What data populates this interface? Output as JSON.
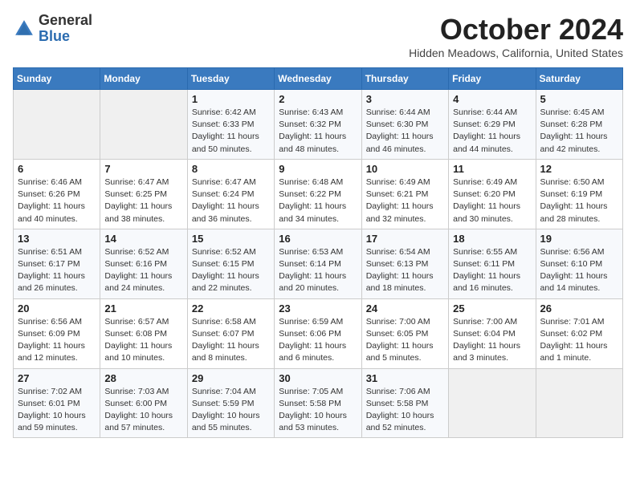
{
  "header": {
    "logo_general": "General",
    "logo_blue": "Blue",
    "month_title": "October 2024",
    "location": "Hidden Meadows, California, United States"
  },
  "days_of_week": [
    "Sunday",
    "Monday",
    "Tuesday",
    "Wednesday",
    "Thursday",
    "Friday",
    "Saturday"
  ],
  "weeks": [
    [
      {
        "day": "",
        "info": ""
      },
      {
        "day": "",
        "info": ""
      },
      {
        "day": "1",
        "info": "Sunrise: 6:42 AM\nSunset: 6:33 PM\nDaylight: 11 hours and 50 minutes."
      },
      {
        "day": "2",
        "info": "Sunrise: 6:43 AM\nSunset: 6:32 PM\nDaylight: 11 hours and 48 minutes."
      },
      {
        "day": "3",
        "info": "Sunrise: 6:44 AM\nSunset: 6:30 PM\nDaylight: 11 hours and 46 minutes."
      },
      {
        "day": "4",
        "info": "Sunrise: 6:44 AM\nSunset: 6:29 PM\nDaylight: 11 hours and 44 minutes."
      },
      {
        "day": "5",
        "info": "Sunrise: 6:45 AM\nSunset: 6:28 PM\nDaylight: 11 hours and 42 minutes."
      }
    ],
    [
      {
        "day": "6",
        "info": "Sunrise: 6:46 AM\nSunset: 6:26 PM\nDaylight: 11 hours and 40 minutes."
      },
      {
        "day": "7",
        "info": "Sunrise: 6:47 AM\nSunset: 6:25 PM\nDaylight: 11 hours and 38 minutes."
      },
      {
        "day": "8",
        "info": "Sunrise: 6:47 AM\nSunset: 6:24 PM\nDaylight: 11 hours and 36 minutes."
      },
      {
        "day": "9",
        "info": "Sunrise: 6:48 AM\nSunset: 6:22 PM\nDaylight: 11 hours and 34 minutes."
      },
      {
        "day": "10",
        "info": "Sunrise: 6:49 AM\nSunset: 6:21 PM\nDaylight: 11 hours and 32 minutes."
      },
      {
        "day": "11",
        "info": "Sunrise: 6:49 AM\nSunset: 6:20 PM\nDaylight: 11 hours and 30 minutes."
      },
      {
        "day": "12",
        "info": "Sunrise: 6:50 AM\nSunset: 6:19 PM\nDaylight: 11 hours and 28 minutes."
      }
    ],
    [
      {
        "day": "13",
        "info": "Sunrise: 6:51 AM\nSunset: 6:17 PM\nDaylight: 11 hours and 26 minutes."
      },
      {
        "day": "14",
        "info": "Sunrise: 6:52 AM\nSunset: 6:16 PM\nDaylight: 11 hours and 24 minutes."
      },
      {
        "day": "15",
        "info": "Sunrise: 6:52 AM\nSunset: 6:15 PM\nDaylight: 11 hours and 22 minutes."
      },
      {
        "day": "16",
        "info": "Sunrise: 6:53 AM\nSunset: 6:14 PM\nDaylight: 11 hours and 20 minutes."
      },
      {
        "day": "17",
        "info": "Sunrise: 6:54 AM\nSunset: 6:13 PM\nDaylight: 11 hours and 18 minutes."
      },
      {
        "day": "18",
        "info": "Sunrise: 6:55 AM\nSunset: 6:11 PM\nDaylight: 11 hours and 16 minutes."
      },
      {
        "day": "19",
        "info": "Sunrise: 6:56 AM\nSunset: 6:10 PM\nDaylight: 11 hours and 14 minutes."
      }
    ],
    [
      {
        "day": "20",
        "info": "Sunrise: 6:56 AM\nSunset: 6:09 PM\nDaylight: 11 hours and 12 minutes."
      },
      {
        "day": "21",
        "info": "Sunrise: 6:57 AM\nSunset: 6:08 PM\nDaylight: 11 hours and 10 minutes."
      },
      {
        "day": "22",
        "info": "Sunrise: 6:58 AM\nSunset: 6:07 PM\nDaylight: 11 hours and 8 minutes."
      },
      {
        "day": "23",
        "info": "Sunrise: 6:59 AM\nSunset: 6:06 PM\nDaylight: 11 hours and 6 minutes."
      },
      {
        "day": "24",
        "info": "Sunrise: 7:00 AM\nSunset: 6:05 PM\nDaylight: 11 hours and 5 minutes."
      },
      {
        "day": "25",
        "info": "Sunrise: 7:00 AM\nSunset: 6:04 PM\nDaylight: 11 hours and 3 minutes."
      },
      {
        "day": "26",
        "info": "Sunrise: 7:01 AM\nSunset: 6:02 PM\nDaylight: 11 hours and 1 minute."
      }
    ],
    [
      {
        "day": "27",
        "info": "Sunrise: 7:02 AM\nSunset: 6:01 PM\nDaylight: 10 hours and 59 minutes."
      },
      {
        "day": "28",
        "info": "Sunrise: 7:03 AM\nSunset: 6:00 PM\nDaylight: 10 hours and 57 minutes."
      },
      {
        "day": "29",
        "info": "Sunrise: 7:04 AM\nSunset: 5:59 PM\nDaylight: 10 hours and 55 minutes."
      },
      {
        "day": "30",
        "info": "Sunrise: 7:05 AM\nSunset: 5:58 PM\nDaylight: 10 hours and 53 minutes."
      },
      {
        "day": "31",
        "info": "Sunrise: 7:06 AM\nSunset: 5:58 PM\nDaylight: 10 hours and 52 minutes."
      },
      {
        "day": "",
        "info": ""
      },
      {
        "day": "",
        "info": ""
      }
    ]
  ]
}
